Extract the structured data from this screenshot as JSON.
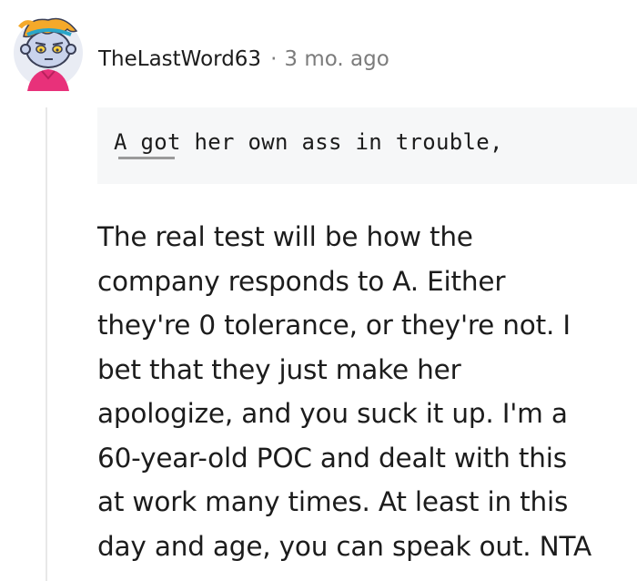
{
  "comment": {
    "author": "TheLastWord63",
    "separator": "·",
    "timestamp": "3 mo. ago",
    "avatar_icon": "snoo-avatar-icon",
    "quoted_code": "A got her own ass in trouble,",
    "body_lines": [
      "The real test will be how the",
      "company responds to A. Either",
      "they're 0 tolerance, or they're not. I",
      "bet that they just make her",
      "apologize, and you suck it up. I'm a",
      "60-year-old POC and dealt with this",
      "at work many times. At least in this",
      "day and age, you can speak out. NTA"
    ]
  },
  "colors": {
    "text": "#1c1c1c",
    "meta": "#7c7c7c",
    "code_bg": "#f6f7f8",
    "thread_line": "#e8e8e8",
    "avatar_hair": "#f4a92a",
    "avatar_shirt": "#e8317a",
    "avatar_skin": "#c9d3ec"
  }
}
